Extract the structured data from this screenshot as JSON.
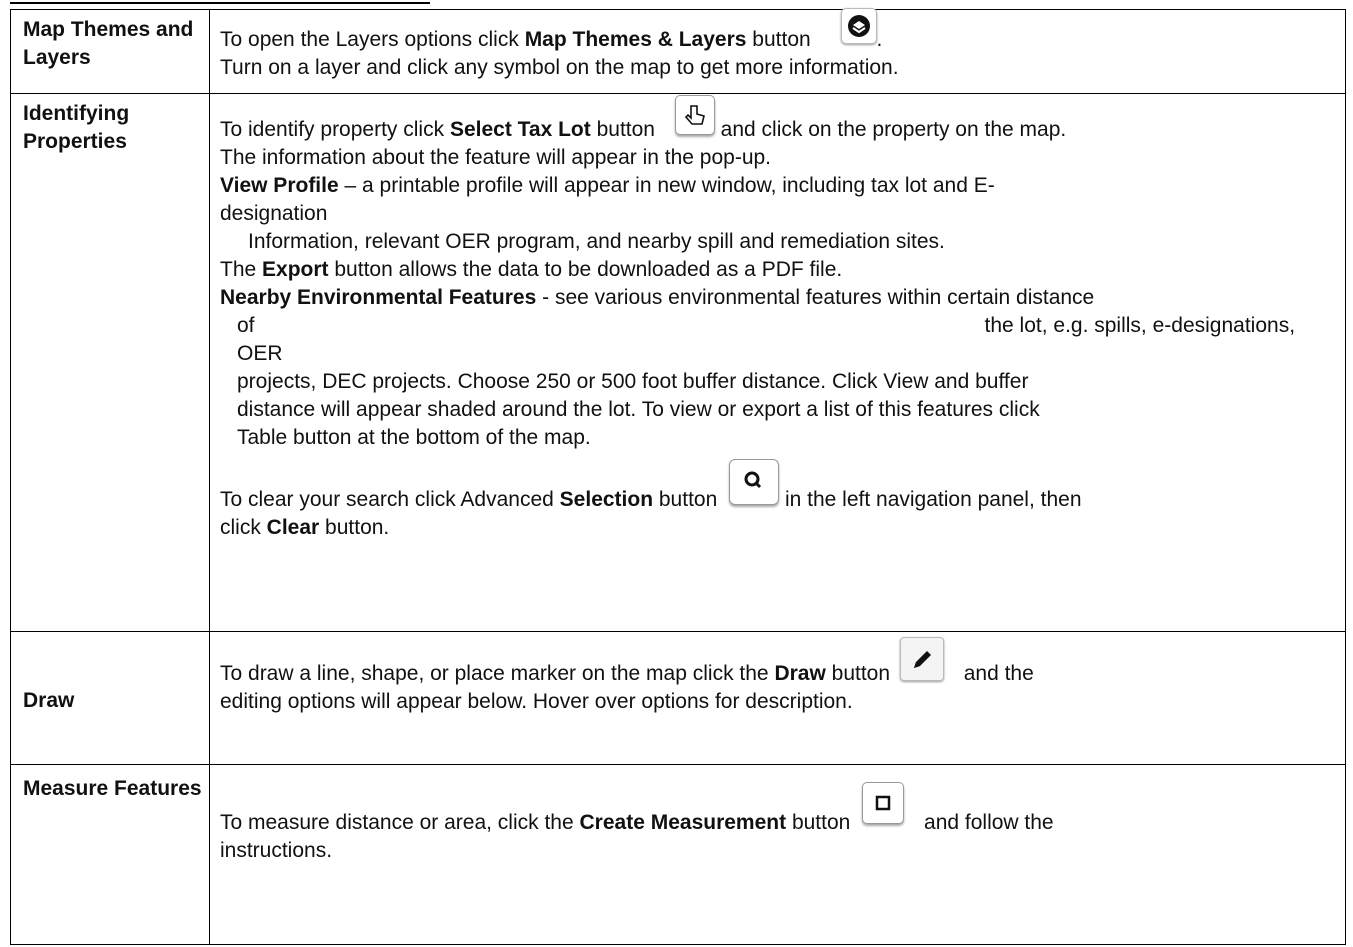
{
  "rows": [
    {
      "label": "Map Themes and Layers",
      "l1_pre": "To open the Layers options click ",
      "l1_bold": "Map Themes & Layers",
      "l1_post": " button",
      "l1_end": ".",
      "l2": "Turn on a layer and click any symbol on the map to get more information."
    },
    {
      "label": "Identifying Properties",
      "l1_pre": "To identify property click ",
      "l1_bold": "Select Tax Lot",
      "l1_post": " button",
      "l1_after": " and click on the property on the map.",
      "l2": "The information about the feature will appear in the pop-up.",
      "vp_bold": "View Profile",
      "vp_text": " – a printable profile will appear in new window, including tax lot and E-",
      "vp_text2": "designation",
      "vp_text3": "Information, relevant OER program, and nearby spill and remediation sites.",
      "ex_pre": "The ",
      "ex_bold": "Export",
      "ex_post": " button allows the data to be downloaded as a PDF file.",
      "nb_bold": "Nearby Environmental Features",
      "nb_text": " - see various environmental features within certain distance",
      "nb_of": "of",
      "nb_rest1": "the lot, e.g. spills, e-designations, OER",
      "nb_rest2": "projects, DEC projects. Choose 250 or 500 foot buffer distance. Click View and buffer",
      "nb_rest3": "distance will appear shaded around the lot. To view or export a list of this features click",
      "nb_rest4": "Table button at the bottom of the map.",
      "cl_pre": "To clear your search click Advanced ",
      "cl_bold": "Selection",
      "cl_post": " button",
      "cl_after": " in the left navigation panel, then",
      "cl2_pre": "click ",
      "cl2_bold": "Clear",
      "cl2_post": " button."
    },
    {
      "label": "Draw",
      "l1_pre": "To draw a line, shape, or place marker on the map click the ",
      "l1_bold": "Draw",
      "l1_post": " button",
      "l1_after": " and the",
      "l2": "editing options will appear below. Hover over options for description."
    },
    {
      "label": "Measure Features",
      "l1_pre": "To measure distance or area, click the ",
      "l1_bold": "Create Measurement",
      "l1_post": " button",
      "l1_after": " and follow the",
      "l2": "instructions."
    }
  ],
  "icons": {
    "layers": "layers-icon",
    "select": "pointer-hand-icon",
    "search": "magnifier-icon",
    "draw": "pencil-icon",
    "measure": "square-measure-icon"
  }
}
